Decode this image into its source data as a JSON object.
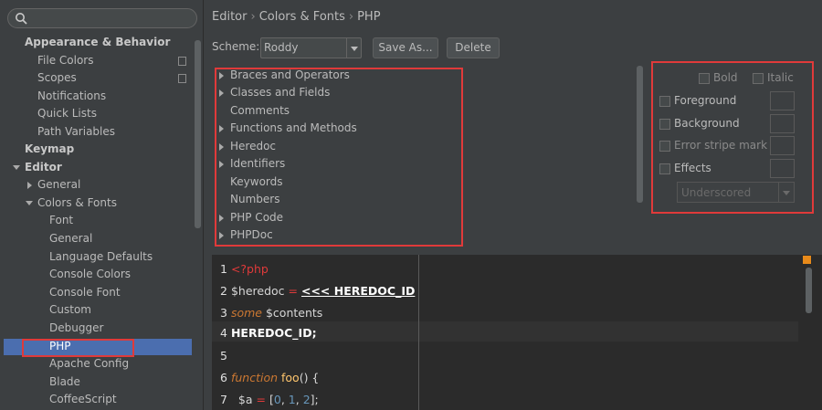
{
  "sidebar": {
    "search_placeholder": "",
    "items": [
      {
        "label": "Appearance & Behavior",
        "bold": true
      },
      {
        "label": "File Colors",
        "copy": true
      },
      {
        "label": "Scopes",
        "copy": true
      },
      {
        "label": "Notifications"
      },
      {
        "label": "Quick Lists"
      },
      {
        "label": "Path Variables"
      },
      {
        "label": "Keymap",
        "bold": true
      },
      {
        "label": "Editor",
        "bold": true
      },
      {
        "label": "General"
      },
      {
        "label": "Colors & Fonts"
      },
      {
        "label": "Font"
      },
      {
        "label": "General"
      },
      {
        "label": "Language Defaults"
      },
      {
        "label": "Console Colors"
      },
      {
        "label": "Console Font"
      },
      {
        "label": "Custom"
      },
      {
        "label": "Debugger"
      },
      {
        "label": "PHP",
        "selected": true
      },
      {
        "label": "Apache Config"
      },
      {
        "label": "Blade"
      },
      {
        "label": "CoffeeScript"
      }
    ]
  },
  "breadcrumb": [
    "Editor",
    "Colors & Fonts",
    "PHP"
  ],
  "scheme": {
    "label": "Scheme:",
    "value": "Roddy",
    "save_as": "Save As...",
    "delete": "Delete"
  },
  "categories": [
    "Braces and Operators",
    "Classes and Fields",
    "Comments",
    "Functions and Methods",
    "Heredoc",
    "Identifiers",
    "Keywords",
    "Numbers",
    "PHP Code",
    "PHPDoc"
  ],
  "attributes": {
    "bold": "Bold",
    "italic": "Italic",
    "foreground": "Foreground",
    "background": "Background",
    "error_stripe": "Error stripe mark",
    "effects": "Effects",
    "effects_style": "Underscored"
  },
  "code": {
    "line_numbers": [
      "1",
      "2",
      "3",
      "4",
      "5",
      "6",
      "7"
    ],
    "l1_tag": "<?php",
    "l2_var": "$heredoc",
    "l2_op": "=",
    "l2_hd": "<<< HEREDOC_ID",
    "l3_some": "some",
    "l3_var": "$contents",
    "l4_hd": "HEREDOC_ID;",
    "l6_kw": "function",
    "l6_fn": "foo",
    "l6_rest": "() {",
    "l7_var": "$a",
    "l7_eq": "=",
    "l7_open": "[",
    "l7_n0": "0",
    "l7_n1": "1",
    "l7_n2": "2",
    "l7_close": "];",
    "l7_c1": ",",
    "l7_c2": ","
  },
  "colors": {
    "selection": "#4b6eaf",
    "annotation_red": "#e03a3a",
    "marker": "#e88a1a"
  }
}
